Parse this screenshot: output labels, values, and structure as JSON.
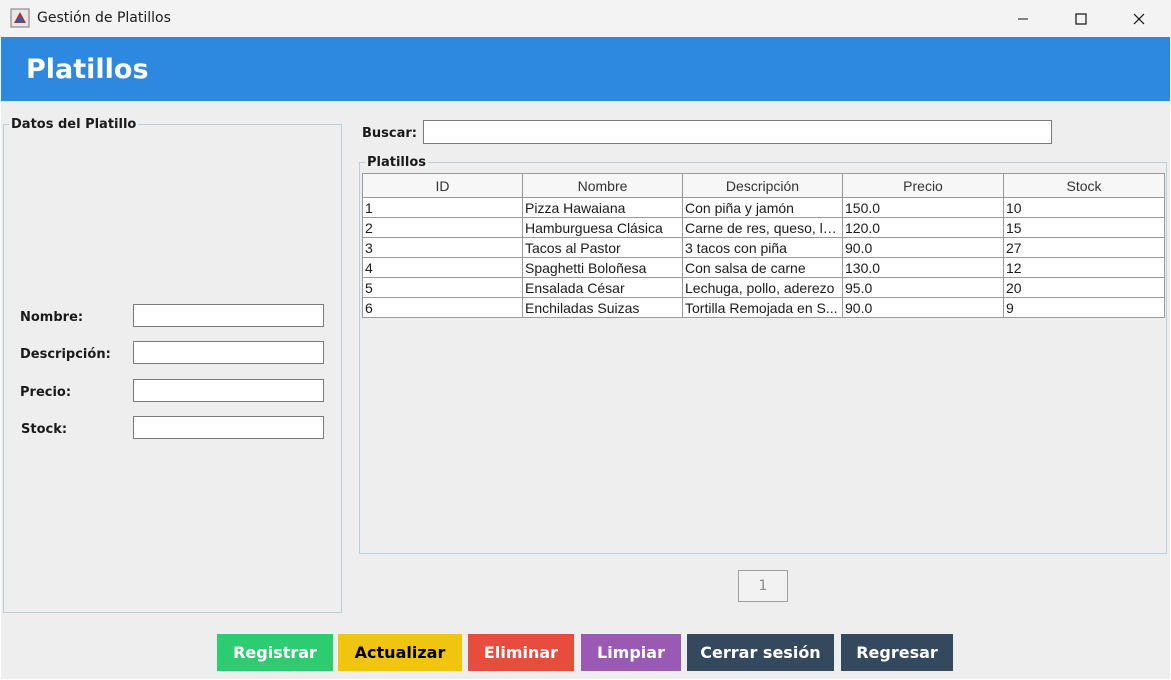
{
  "window": {
    "title": "Gestión de Platillos"
  },
  "header": {
    "title": "Platillos"
  },
  "form": {
    "group_title": "Datos del Platillo",
    "fields": [
      {
        "label": "Nombre:",
        "value": ""
      },
      {
        "label": "Descripción:",
        "value": ""
      },
      {
        "label": "Precio:",
        "value": ""
      },
      {
        "label": "Stock:",
        "value": ""
      }
    ]
  },
  "search": {
    "label": "Buscar:",
    "value": ""
  },
  "table": {
    "group_title": "Platillos",
    "columns": [
      "ID",
      "Nombre",
      "Descripción",
      "Precio",
      "Stock"
    ],
    "rows": [
      [
        "1",
        "Pizza Hawaiana",
        "Con piña y jamón",
        "150.0",
        "10"
      ],
      [
        "2",
        "Hamburguesa Clásica",
        "Carne de res, queso, le...",
        "120.0",
        "15"
      ],
      [
        "3",
        "Tacos al Pastor",
        "3 tacos con piña",
        "90.0",
        "27"
      ],
      [
        "4",
        "Spaghetti Boloñesa",
        "Con salsa de carne",
        "130.0",
        "12"
      ],
      [
        "5",
        "Ensalada César",
        "Lechuga, pollo, aderezo",
        "95.0",
        "20"
      ],
      [
        "6",
        "Enchiladas Suizas",
        "Tortilla Remojada en S...",
        "90.0",
        "9"
      ]
    ]
  },
  "pagination": {
    "current_page": "1"
  },
  "actions": [
    {
      "label": "Registrar",
      "color": "#2ecc71",
      "text_color": "#ffffff"
    },
    {
      "label": "Actualizar",
      "color": "#f1c40f",
      "text_color": "#000000"
    },
    {
      "label": "Eliminar",
      "color": "#e74c3c",
      "text_color": "#ffffff"
    },
    {
      "label": "Limpiar",
      "color": "#9b59b6",
      "text_color": "#ffffff"
    },
    {
      "label": "Cerrar sesión",
      "color": "#34495e",
      "text_color": "#ffffff"
    },
    {
      "label": "Regresar",
      "color": "#34495e",
      "text_color": "#ffffff"
    }
  ],
  "colors": {
    "header_bg": "#2d88e0",
    "content_bg": "#eeeeee",
    "group_border": "#b8cfe0"
  }
}
